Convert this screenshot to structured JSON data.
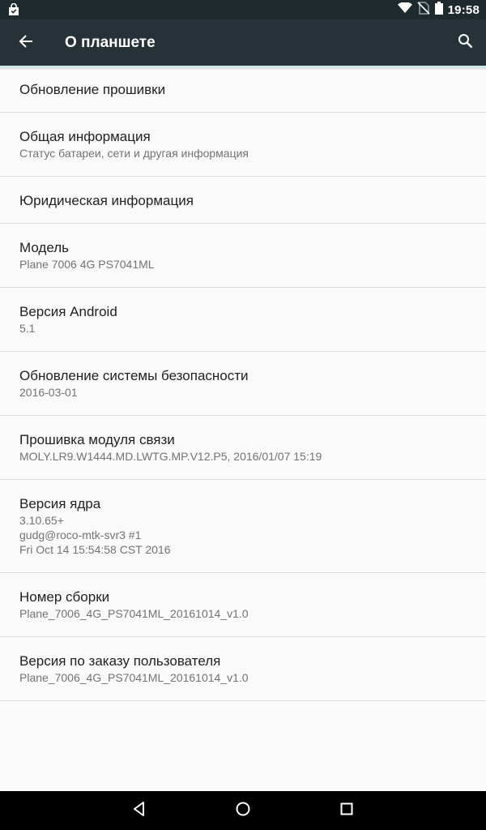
{
  "status_bar": {
    "time": "19:58",
    "icons": [
      "shopping-bag-icon",
      "wifi-icon",
      "no-sim-icon",
      "battery-icon"
    ]
  },
  "toolbar": {
    "title": "О планшете",
    "back_icon": "arrow-back-icon",
    "search_icon": "search-icon"
  },
  "items": [
    {
      "title": "Обновление прошивки",
      "lines": []
    },
    {
      "title": "Общая информация",
      "lines": [
        "Статус батареи, сети и другая информация"
      ]
    },
    {
      "title": "Юридическая информация",
      "lines": []
    },
    {
      "title": "Модель",
      "lines": [
        "Plane 7006 4G PS7041ML"
      ]
    },
    {
      "title": "Версия Android",
      "lines": [
        "5.1"
      ]
    },
    {
      "title": "Обновление системы безопасности",
      "lines": [
        "2016-03-01"
      ]
    },
    {
      "title": "Прошивка модуля связи",
      "lines": [
        "MOLY.LR9.W1444.MD.LWTG.MP.V12.P5, 2016/01/07 15:19"
      ]
    },
    {
      "title": "Версия ядра",
      "lines": [
        "3.10.65+",
        "gudg@roco-mtk-svr3 #1",
        "Fri Oct 14 15:54:58 CST 2016"
      ]
    },
    {
      "title": "Номер сборки",
      "lines": [
        "Plane_7006_4G_PS7041ML_20161014_v1.0"
      ]
    },
    {
      "title": "Версия по заказу пользователя",
      "lines": [
        "Plane_7006_4G_PS7041ML_20161014_v1.0"
      ]
    }
  ],
  "nav_bar": {
    "icons": [
      "back-triangle-icon",
      "home-circle-icon",
      "recents-square-icon"
    ]
  },
  "colors": {
    "status_bar": "#1f2a2e",
    "toolbar": "#263238",
    "background": "#fafafa",
    "divider": "#dedede",
    "title_text": "#212121",
    "subtitle_text": "#737373"
  }
}
